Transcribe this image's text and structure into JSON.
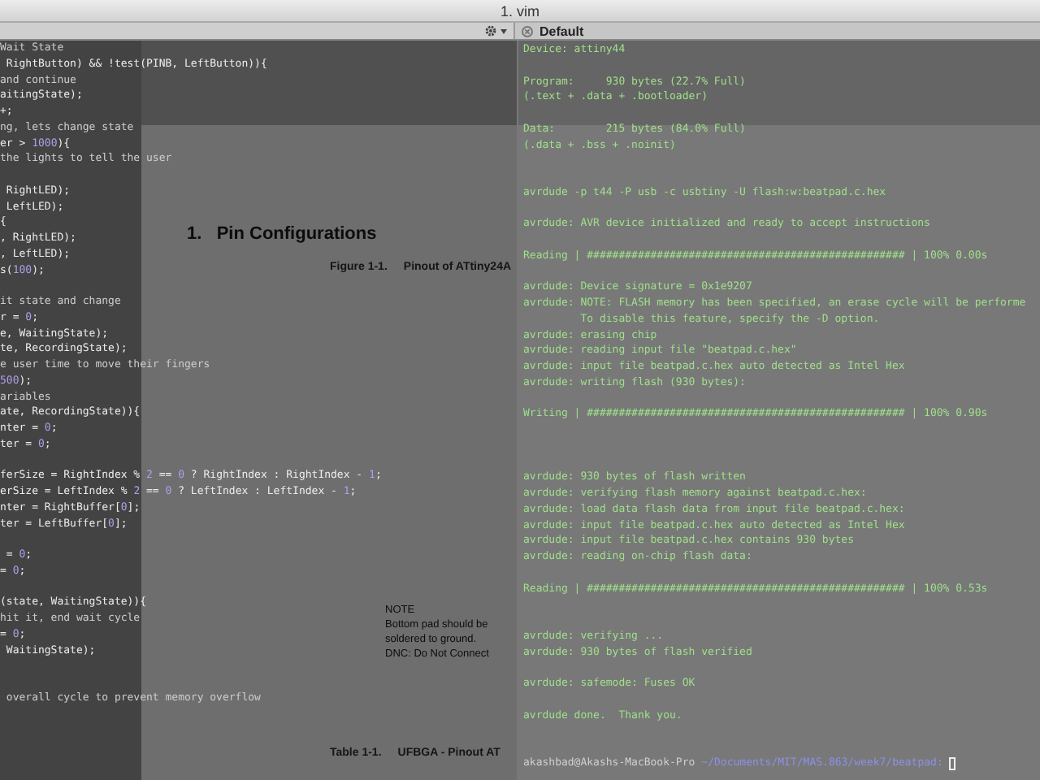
{
  "window": {
    "title": "1. vim"
  },
  "tab": {
    "label": "Default"
  },
  "background_document": {
    "heading": "1.   Pin Configurations",
    "figure_label": "Figure 1-1.",
    "figure_caption": "Pinout of ATtiny24A",
    "note_lines": [
      "NOTE",
      "Bottom pad should be",
      "soldered to ground.",
      "DNC: Do Not Connect"
    ],
    "table_label": "Table 1-1.",
    "table_caption": "UFBGA - Pinout AT"
  },
  "editor": {
    "lines": [
      {
        "kind": "comment",
        "text": "Wait State"
      },
      {
        "kind": "code",
        "text": " RightButton) && !test(PINB, LeftButton)){"
      },
      {
        "kind": "comment",
        "text": "and continue"
      },
      {
        "kind": "code",
        "text": "aitingState);"
      },
      {
        "kind": "code",
        "text": "+;"
      },
      {
        "kind": "comment",
        "text": "ng, lets change state"
      },
      {
        "kind": "code",
        "text": "er > 1000){"
      },
      {
        "kind": "comment",
        "text": "the lights to tell the user"
      },
      {
        "kind": "blank"
      },
      {
        "kind": "code",
        "text": " RightLED);"
      },
      {
        "kind": "code",
        "text": " LeftLED);"
      },
      {
        "kind": "code",
        "text": "{"
      },
      {
        "kind": "code",
        "text": ", RightLED);"
      },
      {
        "kind": "code",
        "text": ", LeftLED);"
      },
      {
        "kind": "code",
        "text": "s(100);"
      },
      {
        "kind": "blank"
      },
      {
        "kind": "comment",
        "text": "it state and change"
      },
      {
        "kind": "code",
        "text": "r = 0;"
      },
      {
        "kind": "code",
        "text": "e, WaitingState);"
      },
      {
        "kind": "code",
        "text": "te, RecordingState);"
      },
      {
        "kind": "comment",
        "text": "e user time to move their fingers"
      },
      {
        "kind": "code",
        "text": "500);"
      },
      {
        "kind": "comment",
        "text": "ariables"
      },
      {
        "kind": "code",
        "text": "ate, RecordingState)){"
      },
      {
        "kind": "code",
        "text": "nter = 0;"
      },
      {
        "kind": "code",
        "text": "ter = 0;"
      },
      {
        "kind": "blank"
      },
      {
        "kind": "code",
        "text": "ferSize = RightIndex % 2 == 0 ? RightIndex : RightIndex - 1;"
      },
      {
        "kind": "code",
        "text": "erSize = LeftIndex % 2 == 0 ? LeftIndex : LeftIndex - 1;"
      },
      {
        "kind": "code",
        "text": "nter = RightBuffer[0];"
      },
      {
        "kind": "code",
        "text": "ter = LeftBuffer[0];"
      },
      {
        "kind": "blank"
      },
      {
        "kind": "code",
        "text": " = 0;"
      },
      {
        "kind": "code",
        "text": "= 0;"
      },
      {
        "kind": "blank"
      },
      {
        "kind": "code",
        "text": "(state, WaitingState)){"
      },
      {
        "kind": "comment",
        "text": "hit it, end wait cycle"
      },
      {
        "kind": "code",
        "text": "= 0;"
      },
      {
        "kind": "code",
        "text": " WaitingState);"
      },
      {
        "kind": "blank"
      },
      {
        "kind": "blank"
      },
      {
        "kind": "comment",
        "text": " overall cycle to prevent memory overflow"
      }
    ]
  },
  "terminal": {
    "lines": [
      {
        "kind": "output",
        "text": "Device: attiny44"
      },
      {
        "kind": "blank"
      },
      {
        "kind": "output",
        "text": "Program:     930 bytes (22.7% Full)"
      },
      {
        "kind": "output",
        "text": "(.text + .data + .bootloader)"
      },
      {
        "kind": "blank"
      },
      {
        "kind": "output",
        "text": "Data:        215 bytes (84.0% Full)"
      },
      {
        "kind": "output",
        "text": "(.data + .bss + .noinit)"
      },
      {
        "kind": "blank"
      },
      {
        "kind": "blank"
      },
      {
        "kind": "output",
        "text": "avrdude -p t44 -P usb -c usbtiny -U flash:w:beatpad.c.hex"
      },
      {
        "kind": "blank"
      },
      {
        "kind": "output",
        "text": "avrdude: AVR device initialized and ready to accept instructions"
      },
      {
        "kind": "blank"
      },
      {
        "kind": "output",
        "text": "Reading | ################################################## | 100% 0.00s"
      },
      {
        "kind": "blank"
      },
      {
        "kind": "output",
        "text": "avrdude: Device signature = 0x1e9207"
      },
      {
        "kind": "output",
        "text": "avrdude: NOTE: FLASH memory has been specified, an erase cycle will be performe"
      },
      {
        "kind": "output",
        "text": "         To disable this feature, specify the -D option."
      },
      {
        "kind": "output",
        "text": "avrdude: erasing chip"
      },
      {
        "kind": "output",
        "text": "avrdude: reading input file \"beatpad.c.hex\""
      },
      {
        "kind": "output",
        "text": "avrdude: input file beatpad.c.hex auto detected as Intel Hex"
      },
      {
        "kind": "output",
        "text": "avrdude: writing flash (930 bytes):"
      },
      {
        "kind": "blank"
      },
      {
        "kind": "output",
        "text": "Writing | ################################################## | 100% 0.90s"
      },
      {
        "kind": "blank"
      },
      {
        "kind": "blank"
      },
      {
        "kind": "blank"
      },
      {
        "kind": "output",
        "text": "avrdude: 930 bytes of flash written"
      },
      {
        "kind": "output",
        "text": "avrdude: verifying flash memory against beatpad.c.hex:"
      },
      {
        "kind": "output",
        "text": "avrdude: load data flash data from input file beatpad.c.hex:"
      },
      {
        "kind": "output",
        "text": "avrdude: input file beatpad.c.hex auto detected as Intel Hex"
      },
      {
        "kind": "output",
        "text": "avrdude: input file beatpad.c.hex contains 930 bytes"
      },
      {
        "kind": "output",
        "text": "avrdude: reading on-chip flash data:"
      },
      {
        "kind": "blank"
      },
      {
        "kind": "output",
        "text": "Reading | ################################################## | 100% 0.53s"
      },
      {
        "kind": "blank"
      },
      {
        "kind": "blank"
      },
      {
        "kind": "output",
        "text": "avrdude: verifying ..."
      },
      {
        "kind": "output",
        "text": "avrdude: 930 bytes of flash verified"
      },
      {
        "kind": "blank"
      },
      {
        "kind": "output",
        "text": "avrdude: safemode: Fuses OK"
      },
      {
        "kind": "blank"
      },
      {
        "kind": "output",
        "text": "avrdude done.  Thank you."
      },
      {
        "kind": "blank"
      },
      {
        "kind": "blank"
      }
    ],
    "prompt": {
      "user_host": "akashbad@Akashs-MacBook-Pro",
      "path": "~/Documents/MIT/MAS.863/week7/beatpad:"
    }
  }
}
